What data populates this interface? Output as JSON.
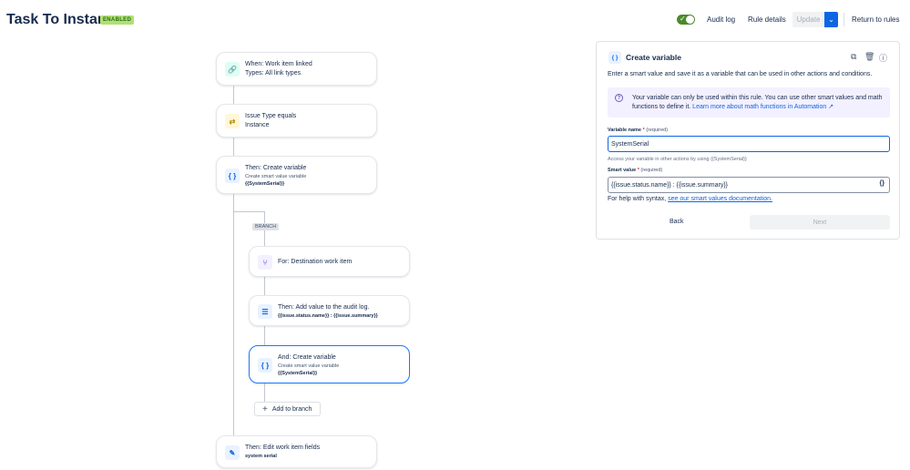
{
  "header": {
    "title": "Task To Instance",
    "badge": "ENABLED",
    "audit_log": "Audit log",
    "rule_details": "Rule details",
    "update": "Update",
    "return_to_rules": "Return to rules"
  },
  "flow": {
    "trigger": {
      "line1": "When: Work item linked",
      "line2": "Types: All link types"
    },
    "condition": {
      "line1": "Issue Type equals",
      "line2": "Instance"
    },
    "create_var_1": {
      "title": "Then: Create variable",
      "sub": "Create smart value variable",
      "value": "{{SystemSerial}}"
    },
    "branch_tag": "BRANCH",
    "branch_for": {
      "title": "For: Destination work item"
    },
    "audit": {
      "title": "Then: Add value to the audit log.",
      "value": "{{issue.status.name}} : {{issue.summary}}"
    },
    "create_var_2": {
      "title": "And: Create variable",
      "sub": "Create smart value variable",
      "value": "{{SystemSerial}}"
    },
    "add_to_branch": "Add to branch",
    "edit_fields": {
      "title": "Then: Edit work item fields",
      "value": "system serial"
    }
  },
  "panel": {
    "title": "Create variable",
    "description": "Enter a smart value and save it as a variable that can be used in other actions and conditions.",
    "info_text": "Your variable can only be used within this rule. You can use other smart values and math functions to define it.",
    "info_link": "Learn more about math functions in Automation ↗",
    "var_name_label": "Variable name",
    "var_name_star": "*",
    "var_name_req": "(required)",
    "var_name_value": "SystemSerial",
    "var_name_help": "Access your variable in other actions by using {{SystemSerial}}",
    "smart_value_label": "Smart value",
    "smart_value_star": "*",
    "smart_value_req": "(required)",
    "smart_value_value": "{{issue.status.name}} : {{issue.summary}}",
    "syntax_help": "For help with syntax,",
    "syntax_link": "see our smart values documentation.",
    "back": "Back",
    "next": "Next"
  },
  "colors": {
    "accent": "#0c66e4",
    "enabled_badge": "#b3df72",
    "toggle_on": "#4b8a2b"
  }
}
